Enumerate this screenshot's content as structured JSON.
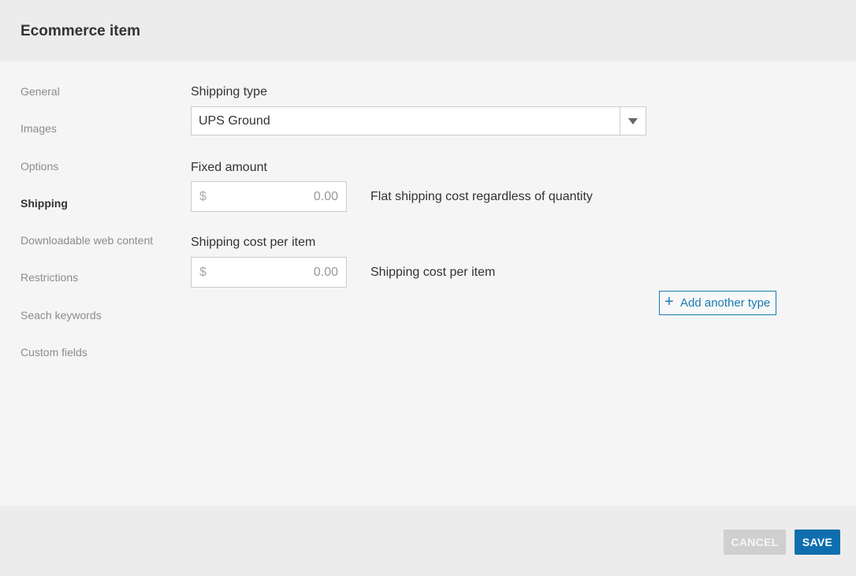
{
  "window": {
    "title": "Ecommerce item"
  },
  "sidebar": {
    "items": [
      {
        "label": "General",
        "active": false
      },
      {
        "label": "Images",
        "active": false
      },
      {
        "label": "Options",
        "active": false
      },
      {
        "label": "Shipping",
        "active": true
      },
      {
        "label": "Downloadable web content",
        "active": false
      },
      {
        "label": "Restrictions",
        "active": false
      },
      {
        "label": "Seach keywords",
        "active": false
      },
      {
        "label": "Custom fields",
        "active": false
      }
    ]
  },
  "shipping": {
    "type_label": "Shipping type",
    "type_value": "UPS Ground",
    "fixed_label": "Fixed amount",
    "fixed_currency": "$",
    "fixed_placeholder": "0.00",
    "fixed_hint": "Flat shipping cost regardless of quantity",
    "per_item_label": "Shipping cost per item",
    "per_item_currency": "$",
    "per_item_placeholder": "0.00",
    "per_item_hint": "Shipping cost per item",
    "add_type_label": "Add another type"
  },
  "footer": {
    "cancel_label": "CANCEL",
    "save_label": "SAVE"
  },
  "colors": {
    "accent": "#0f6fae",
    "link": "#1a7bb3",
    "disabled": "#cfcfcf"
  },
  "icons": {
    "dropdown": "chevron-down-icon",
    "add": "plus-icon"
  }
}
